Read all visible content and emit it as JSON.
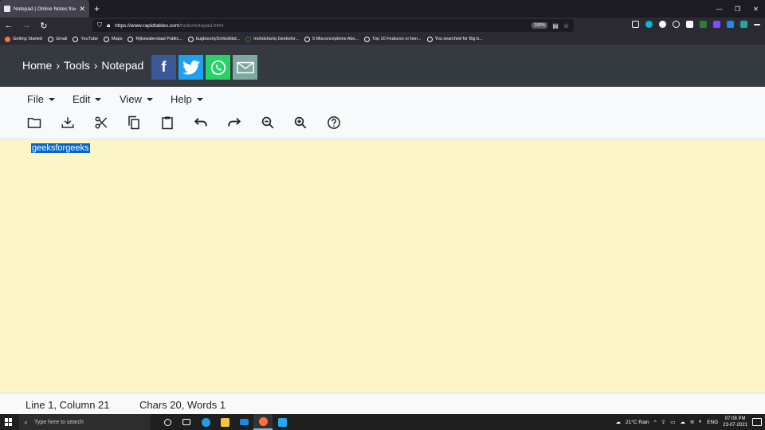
{
  "browser": {
    "tab_title": "Notepad | Online Notes free, n...",
    "url_domain": "https://www.rapidtables.com",
    "url_path": "/tools/notepad.html",
    "zoom": "160%",
    "bookmarks": [
      "Getting Started",
      "Gmail",
      "YouTube",
      "Maps",
      "Rijkswaterstaat Public...",
      "bugbountyDorks/bbd...",
      "mohdshariq Geeksfor...",
      "5 Misconceptions Abo...",
      "Top 10 Features or ben...",
      "You searched for Big b..."
    ]
  },
  "header": {
    "breadcrumb": [
      "Home",
      "Tools",
      "Notepad"
    ],
    "separator": "›"
  },
  "menu": {
    "items": [
      "File",
      "Edit",
      "View",
      "Help"
    ]
  },
  "toolbar": {
    "icons": [
      "open-icon",
      "download-icon",
      "cut-icon",
      "copy-icon",
      "paste-icon",
      "undo-icon",
      "redo-icon",
      "zoom-out-icon",
      "zoom-in-icon",
      "help-icon"
    ]
  },
  "editor": {
    "content": "geeksforgeeks"
  },
  "status": {
    "position": "Line 1, Column 21",
    "counts": "Chars 20, Words 1"
  },
  "taskbar": {
    "search_placeholder": "Type here to search",
    "weather": "21°C  Rain",
    "language": "ENG",
    "time": "07:08 PM",
    "date": "23-07-2021"
  },
  "colors": {
    "header_bg": "#343a40",
    "editor_bg": "#fcf5c7",
    "selection": "#0066cc",
    "facebook": "#3b5998",
    "twitter": "#1da1f2",
    "whatsapp": "#25d366",
    "email": "#7fa8a1"
  }
}
